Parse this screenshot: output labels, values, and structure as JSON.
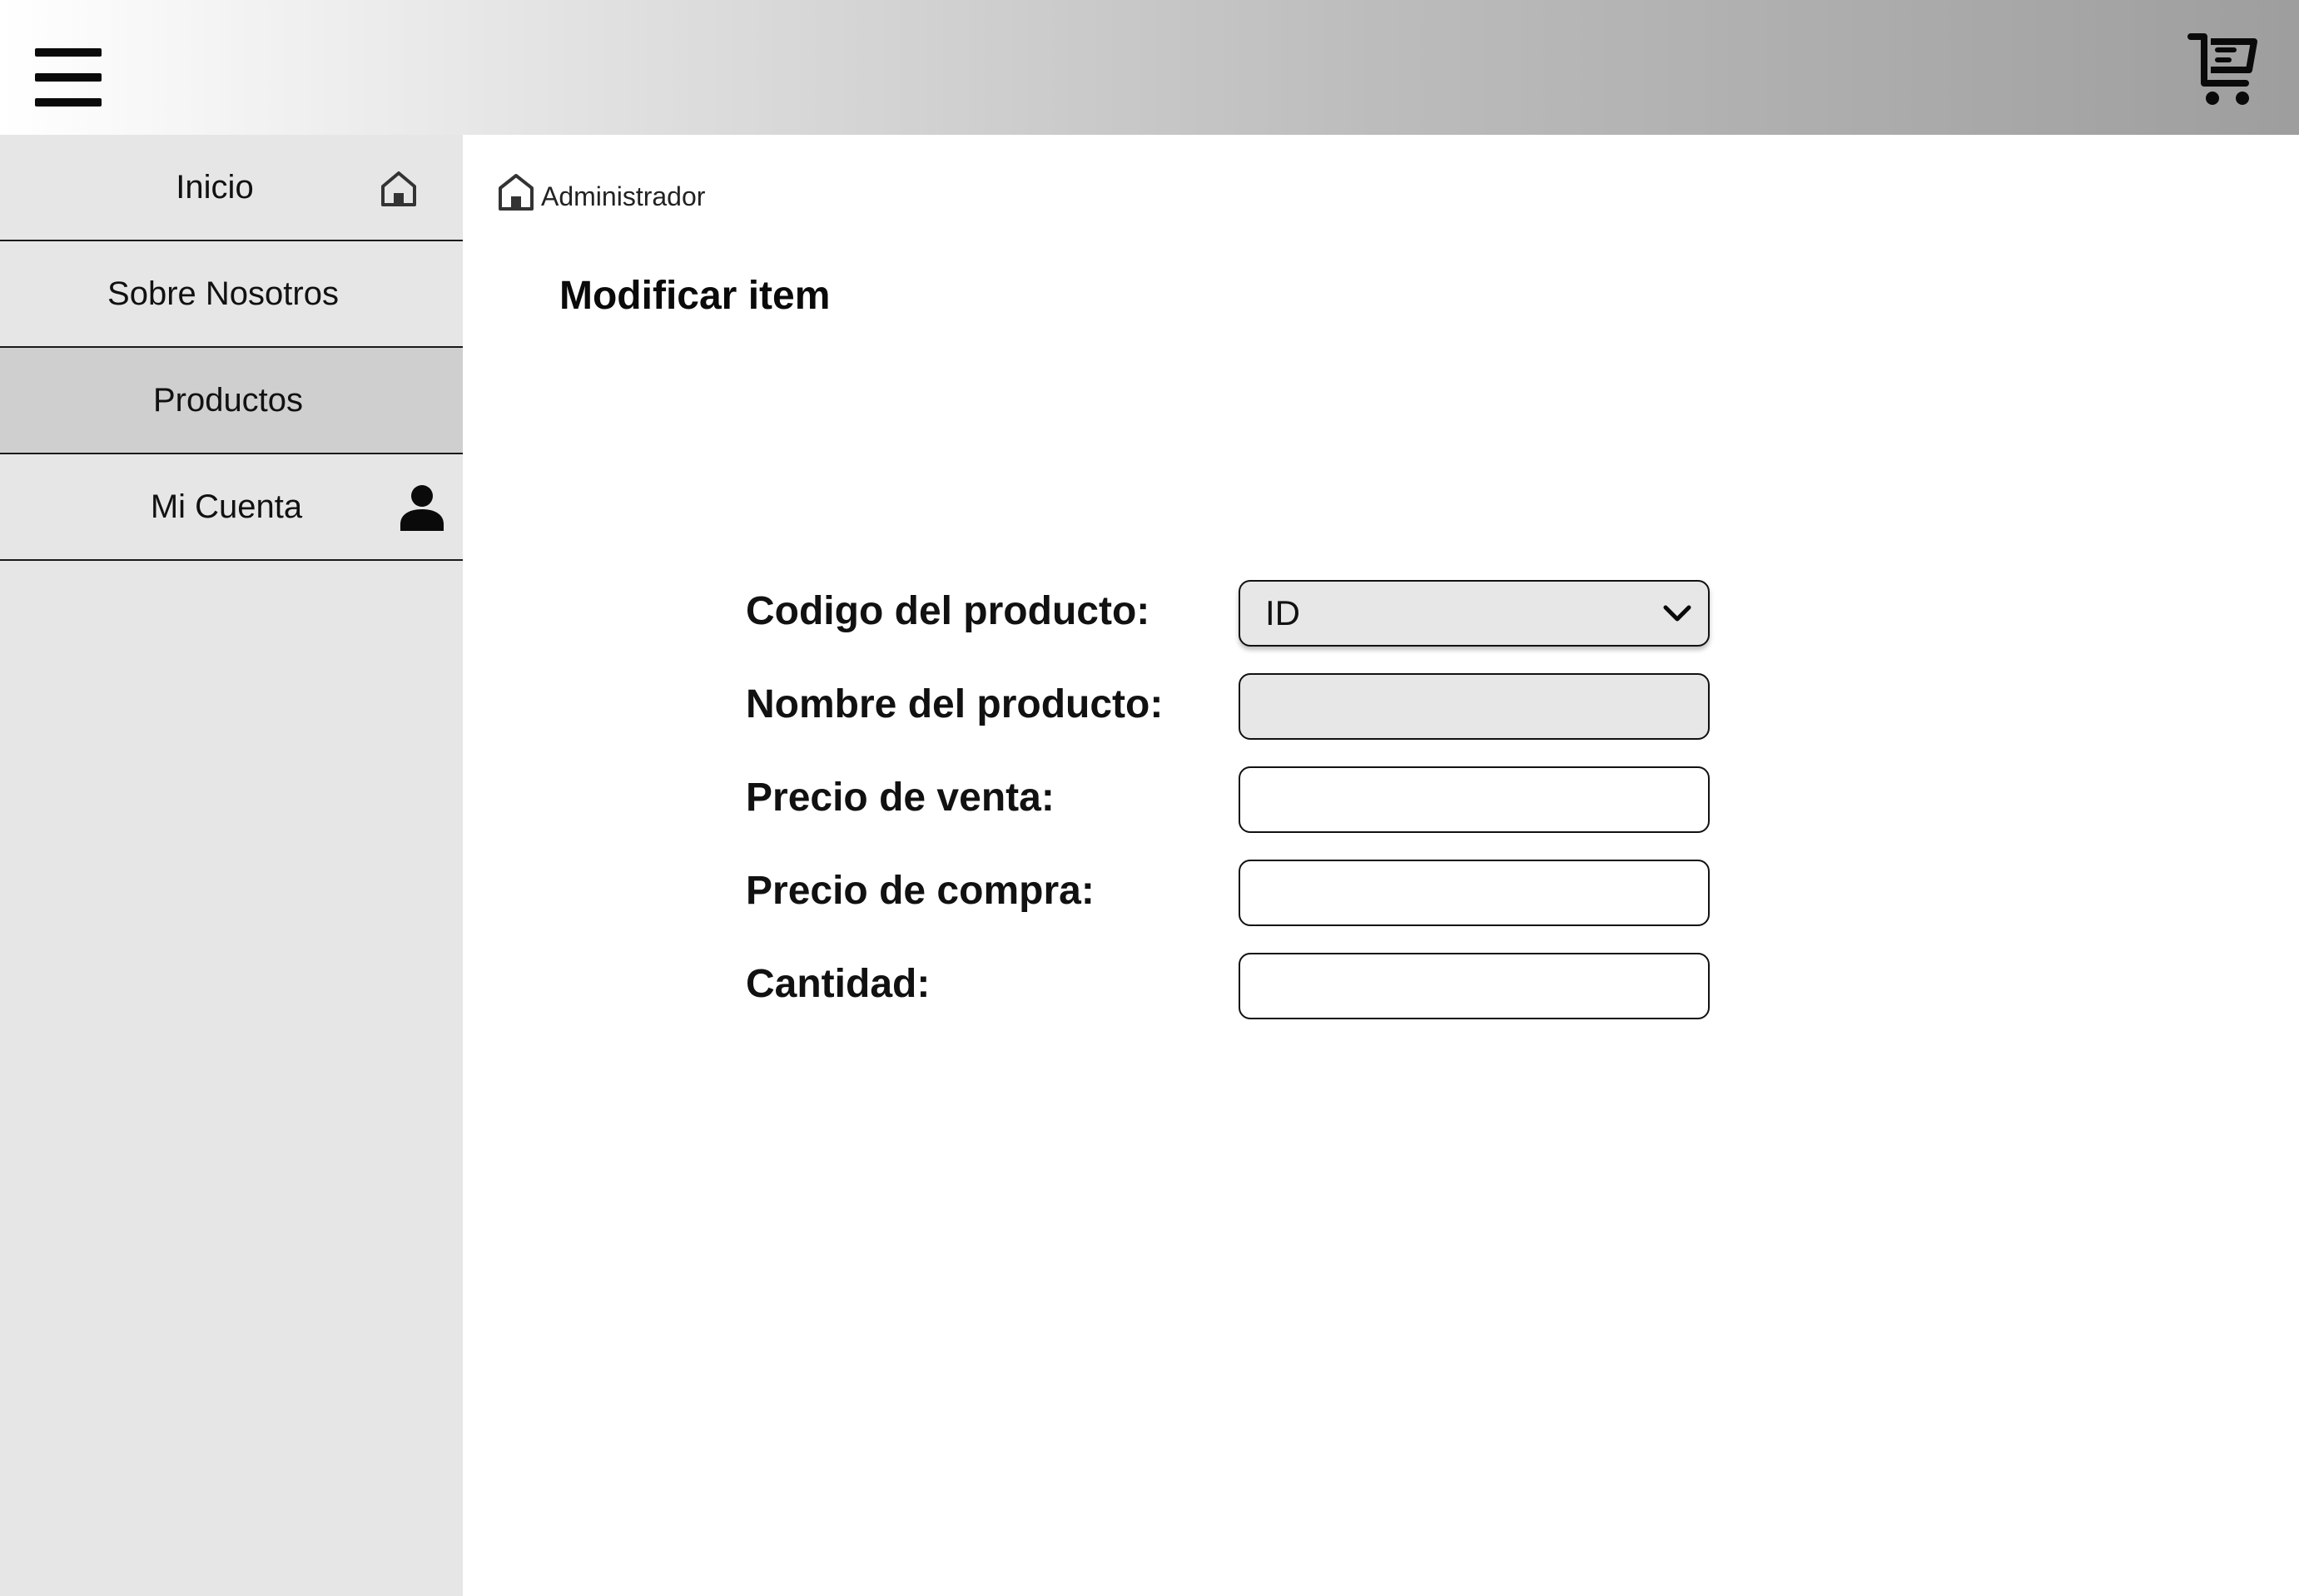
{
  "header": {
    "menu_icon": "hamburger-menu-icon",
    "cart_icon": "shopping-cart-icon"
  },
  "sidebar": {
    "items": [
      {
        "label": "Inicio",
        "icon": "home-icon",
        "active": false
      },
      {
        "label": "Sobre Nosotros",
        "icon": null,
        "active": false
      },
      {
        "label": "Productos",
        "icon": null,
        "active": true
      },
      {
        "label": "Mi Cuenta",
        "icon": "user-icon",
        "active": false
      }
    ]
  },
  "breadcrumb": {
    "icon": "home-icon",
    "label": "Administrador"
  },
  "main": {
    "title": "Modificar item"
  },
  "form": {
    "codigo": {
      "label": "Codigo del producto:",
      "selected_value": "ID"
    },
    "nombre": {
      "label": "Nombre del producto:",
      "value": ""
    },
    "precio_venta": {
      "label": "Precio de venta:",
      "value": ""
    },
    "precio_compra": {
      "label": "Precio de compra:",
      "value": ""
    },
    "cantidad": {
      "label": "Cantidad:",
      "value": ""
    }
  },
  "colors": {
    "sidebar_bg": "#e6e6e6",
    "sidebar_active_bg": "#cfcfcf",
    "field_fill": "#e7e7e7",
    "text": "#111111"
  }
}
